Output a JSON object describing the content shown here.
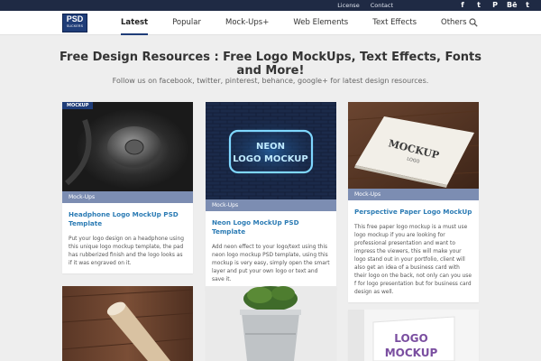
{
  "topbar": {
    "links": [
      "License",
      "Contact"
    ],
    "social": [
      {
        "icon": "facebook-icon",
        "glyph": "f"
      },
      {
        "icon": "twitter-icon",
        "glyph": "t"
      },
      {
        "icon": "pinterest-icon",
        "glyph": "P"
      },
      {
        "icon": "behance-icon",
        "glyph": "Bē"
      },
      {
        "icon": "tumblr-icon",
        "glyph": "t"
      }
    ]
  },
  "nav": {
    "logo_big": "PSD",
    "logo_small": "SUCKERS",
    "items": [
      "Latest",
      "Popular",
      "Mock-Ups+",
      "Web Elements",
      "Text Effects",
      "Others"
    ],
    "active": "Latest"
  },
  "hero": {
    "title": "Free Design Resources : Free Logo MockUps, Text Effects, Fonts and More!",
    "subtitle": "Follow us on facebook, twitter, pinterest, behance, google+ for latest design resources."
  },
  "cards": [
    {
      "badge": "MOCKUP",
      "category": "Mock-Ups",
      "title": "Headphone Logo MockUp PSD Template",
      "desc": "Put your logo design on a headphone using this unique logo mockup template, the pad has rubberized finish and the logo looks as if it was engraved on it."
    },
    {
      "neon_line1": "NEON",
      "neon_line2": "LOGO MOCKUP",
      "category": "Mock-Ups",
      "title": "Neon Logo MockUp PSD Template",
      "desc": "Add neon effect to your logo/text using this neon logo mockup PSD template, using this mockup is very easy, simply open the smart layer and put your own logo or text and save it."
    },
    {
      "paper_line1": "MOCKUP",
      "paper_line2": "LOGO",
      "category": "Mock-Ups",
      "title": "Perspective Paper Logo MockUp",
      "desc": "This free paper logo mockup is a must use logo mockup if you are looking for professional presentation and want to impress the viewers, this will make your logo stand out in your portfolio, client will also get an idea of a business card with their logo on the back, not only can you use f for logo presentation but for business card design as well."
    }
  ],
  "row2": {
    "wall_line1": "LOGO",
    "wall_line2": "MOCKUP"
  },
  "colors": {
    "topbar": "#1f2a44",
    "brand": "#1f3d78",
    "category_bar": "#7c8db2",
    "link": "#2b7bb4"
  }
}
